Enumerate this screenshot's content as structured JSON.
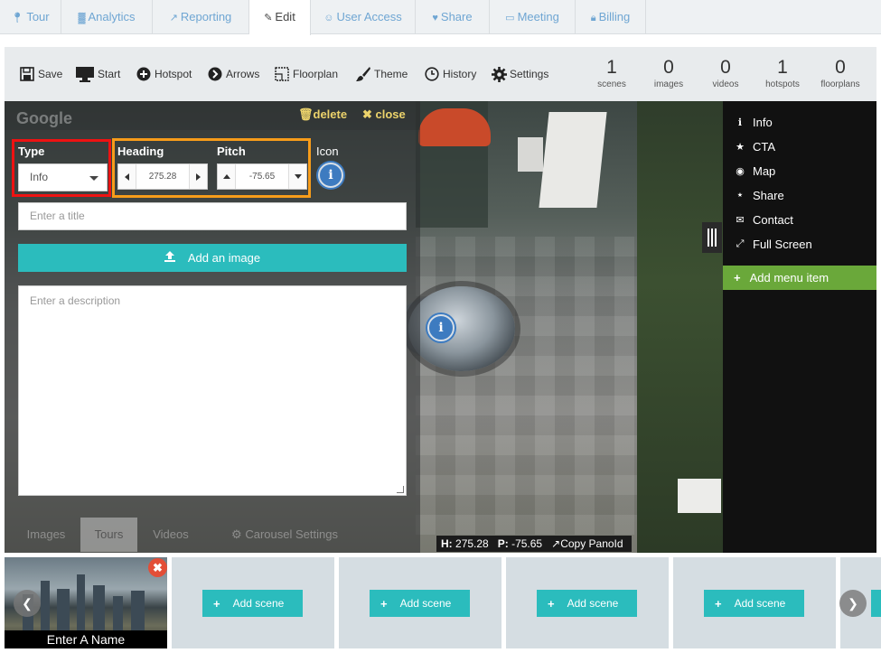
{
  "tabs": [
    {
      "label": "Tour",
      "icon": "map-marker-icon"
    },
    {
      "label": "Analytics",
      "icon": "bar-chart-icon"
    },
    {
      "label": "Reporting",
      "icon": "line-chart-icon"
    },
    {
      "label": "Edit",
      "icon": "pencil-icon",
      "active": true
    },
    {
      "label": "User Access",
      "icon": "users-icon"
    },
    {
      "label": "Share",
      "icon": "heart-icon"
    },
    {
      "label": "Meeting",
      "icon": "monitor-icon"
    },
    {
      "label": "Billing",
      "icon": "lock-icon"
    }
  ],
  "toolbar": {
    "save": "Save",
    "start": "Start",
    "hotspot": "Hotspot",
    "arrows": "Arrows",
    "floorplan": "Floorplan",
    "theme": "Theme",
    "history": "History",
    "settings": "Settings"
  },
  "stats": [
    {
      "value": "1",
      "label": "scenes"
    },
    {
      "value": "0",
      "label": "images"
    },
    {
      "value": "0",
      "label": "videos"
    },
    {
      "value": "1",
      "label": "hotspots"
    },
    {
      "value": "0",
      "label": "floorplans"
    }
  ],
  "viewer": {
    "watermark": "Google",
    "delete_label": "delete",
    "close_label": "close",
    "hotspot_icon": "i"
  },
  "hotspot_form": {
    "type_label": "Type",
    "type_value": "Info",
    "heading_label": "Heading",
    "heading_value": "275.28",
    "pitch_label": "Pitch",
    "pitch_value": "-75.65",
    "icon_label": "Icon",
    "icon_glyph": "i",
    "title_placeholder": "Enter a title",
    "add_image_label": "Add an image",
    "description_placeholder": "Enter a description"
  },
  "bottom_tabs": {
    "images": "Images",
    "tours": "Tours",
    "videos": "Videos",
    "carousel": "Carousel Settings"
  },
  "coords": {
    "h_label": "H:",
    "h_value": "275.28",
    "p_label": "P:",
    "p_value": "-75.65",
    "copy_label": "Copy PanoId"
  },
  "right_menu": {
    "items": [
      {
        "label": "Info",
        "icon": "info-icon"
      },
      {
        "label": "CTA",
        "icon": "star-icon"
      },
      {
        "label": "Map",
        "icon": "map-marker-icon"
      },
      {
        "label": "Share",
        "icon": "share-icon"
      },
      {
        "label": "Contact",
        "icon": "envelope-icon"
      },
      {
        "label": "Full Screen",
        "icon": "expand-icon"
      }
    ],
    "add_item": "Add menu item"
  },
  "scenes": {
    "first_name": "Enter A Name",
    "add_scene_label": "Add scene"
  },
  "colors": {
    "accent_teal": "#2bbcbd",
    "menu_green": "#6aa83a",
    "highlight_red": "#ee1212",
    "highlight_orange": "#f79c1a",
    "close_red": "#e34e37"
  }
}
